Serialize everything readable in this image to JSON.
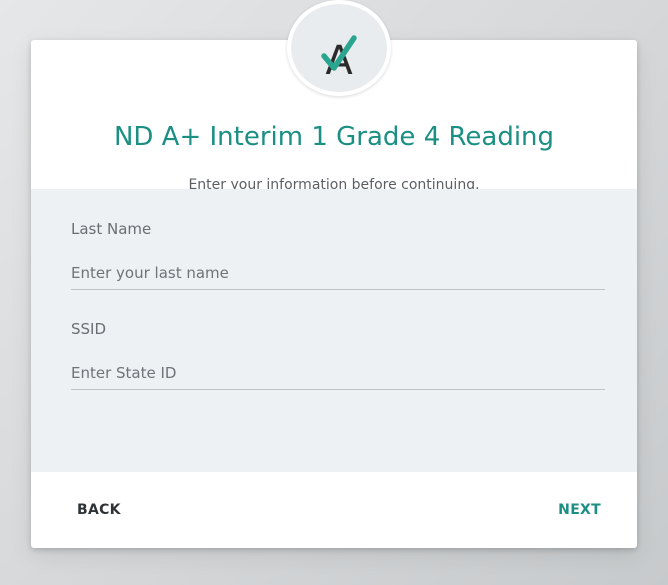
{
  "logo": {
    "letter": "A",
    "check_color": "#2aa58f",
    "letter_color": "#2b2b2b"
  },
  "header": {
    "title": "ND A+ Interim 1 Grade 4 Reading",
    "subtitle": "Enter your information before continuing."
  },
  "form": {
    "last_name": {
      "label": "Last Name",
      "placeholder": "Enter your last name",
      "value": ""
    },
    "ssid": {
      "label": "SSID",
      "placeholder": "Enter State ID",
      "value": ""
    }
  },
  "footer": {
    "back_label": "BACK",
    "next_label": "NEXT"
  },
  "colors": {
    "accent": "#1b8f83",
    "form_background": "#eef1f3",
    "page_background": "#d6d8da"
  }
}
